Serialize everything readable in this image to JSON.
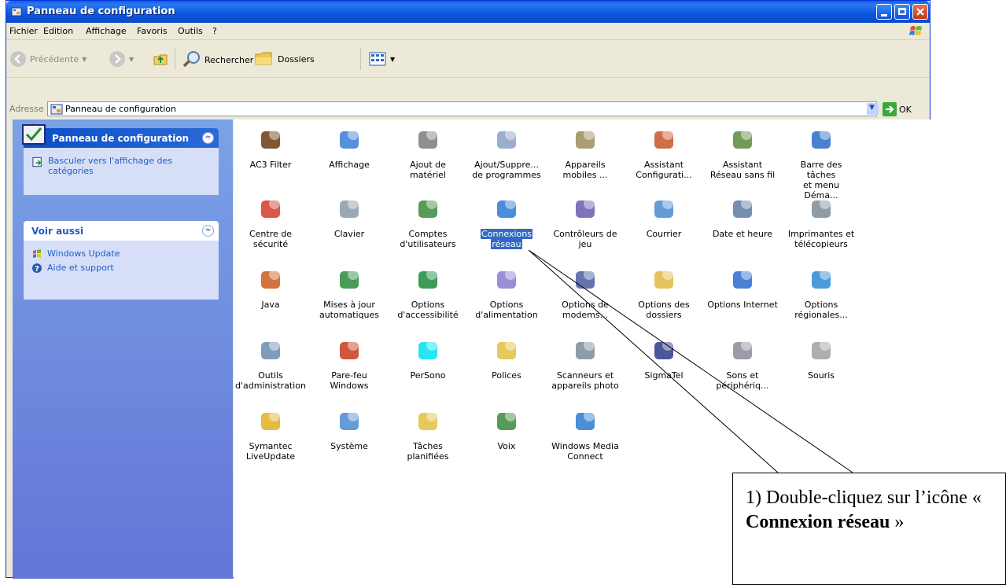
{
  "window": {
    "title": "Panneau de configuration"
  },
  "menu": [
    "Fichier",
    "Edition",
    "Affichage",
    "Favoris",
    "Outils",
    "?"
  ],
  "toolbar": {
    "back": "Précédente",
    "search": "Rechercher",
    "folders": "Dossiers"
  },
  "address": {
    "label": "Adresse",
    "value": "Panneau de configuration",
    "go": "OK"
  },
  "sidebar": {
    "panel_title": "Panneau de configuration",
    "switch_link": "Basculer vers l'affichage des catégories",
    "see_also_title": "Voir aussi",
    "see_also": [
      "Windows Update",
      "Aide et support"
    ]
  },
  "items": [
    {
      "line1": "AC3 Filter",
      "line2": "",
      "icon": "ac3-filter-icon",
      "color": "#6b3a10"
    },
    {
      "line1": "Affichage",
      "line2": "",
      "icon": "display-icon",
      "color": "#3a7bd5"
    },
    {
      "line1": "Ajout de",
      "line2": "matériel",
      "icon": "add-hardware-icon",
      "color": "#7a7a7a"
    },
    {
      "line1": "Ajout/Suppre...",
      "line2": "de programmes",
      "icon": "add-remove-programs-icon",
      "color": "#8aa0c8"
    },
    {
      "line1": "Appareils",
      "line2": "mobiles ...",
      "icon": "mobile-devices-icon",
      "color": "#9c8c5a"
    },
    {
      "line1": "Assistant",
      "line2": "Configurati...",
      "icon": "setup-wizard-icon",
      "color": "#c8552a"
    },
    {
      "line1": "Assistant",
      "line2": "Réseau sans fil",
      "icon": "wireless-network-icon",
      "color": "#5a8a3a"
    },
    {
      "line1": "Barre des tâches",
      "line2": "et menu Déma...",
      "icon": "taskbar-icon",
      "color": "#2a6ac8"
    },
    {
      "line1": "Centre de",
      "line2": "sécurité",
      "icon": "security-center-icon",
      "color": "#d43a2a"
    },
    {
      "line1": "Clavier",
      "line2": "",
      "icon": "keyboard-icon",
      "color": "#8a9aaa"
    },
    {
      "line1": "Comptes",
      "line2": "d'utilisateurs",
      "icon": "user-accounts-icon",
      "color": "#3a8a3a"
    },
    {
      "line1": "Connexions",
      "line2": "réseau",
      "icon": "network-connections-icon",
      "color": "#2a7ad5"
    },
    {
      "line1": "Contrôleurs de",
      "line2": "jeu",
      "icon": "game-controller-icon",
      "color": "#6a5ab0"
    },
    {
      "line1": "Courrier",
      "line2": "",
      "icon": "mail-icon",
      "color": "#4a8ad0"
    },
    {
      "line1": "Date et heure",
      "line2": "",
      "icon": "date-time-icon",
      "color": "#5a7aa0"
    },
    {
      "line1": "Imprimantes et",
      "line2": "télécopieurs",
      "icon": "printers-icon",
      "color": "#7a8a9a"
    },
    {
      "line1": "Java",
      "line2": "",
      "icon": "java-icon",
      "color": "#c85a1a"
    },
    {
      "line1": "Mises à jour",
      "line2": "automatiques",
      "icon": "automatic-updates-icon",
      "color": "#2a8a3a"
    },
    {
      "line1": "Options",
      "line2": "d'accessibilité",
      "icon": "accessibility-icon",
      "color": "#1a8a3a"
    },
    {
      "line1": "Options",
      "line2": "d'alimentation",
      "icon": "power-options-icon",
      "color": "#8a7ad0"
    },
    {
      "line1": "Options de",
      "line2": "modems...",
      "icon": "modem-icon",
      "color": "#4a5aa0"
    },
    {
      "line1": "Options des",
      "line2": "dossiers",
      "icon": "folder-options-icon",
      "color": "#e0b840"
    },
    {
      "line1": "Options Internet",
      "line2": "",
      "icon": "internet-options-icon",
      "color": "#2a6ad0"
    },
    {
      "line1": "Options",
      "line2": "régionales...",
      "icon": "regional-options-icon",
      "color": "#2a8ad0"
    },
    {
      "line1": "Outils",
      "line2": "d'administration",
      "icon": "admin-tools-icon",
      "color": "#6a8ab0"
    },
    {
      "line1": "Pare-feu",
      "line2": "Windows",
      "icon": "firewall-icon",
      "color": "#c83a1a"
    },
    {
      "line1": "PerSono",
      "line2": "",
      "icon": "persono-icon",
      "color": "#00e0f0"
    },
    {
      "line1": "Polices",
      "line2": "",
      "icon": "fonts-icon",
      "color": "#e0c040"
    },
    {
      "line1": "Scanneurs et",
      "line2": "appareils photo",
      "icon": "scanner-icon",
      "color": "#7a8a9a"
    },
    {
      "line1": "SigmaTel",
      "line2": "",
      "icon": "sigmatel-icon",
      "color": "#2a3a8a"
    },
    {
      "line1": "Sons et",
      "line2": "périphériq...",
      "icon": "sounds-icon",
      "color": "#8a8a9a"
    },
    {
      "line1": "Souris",
      "line2": "",
      "icon": "mouse-icon",
      "color": "#a0a0a0"
    },
    {
      "line1": "Symantec",
      "line2": "LiveUpdate",
      "icon": "symantec-icon",
      "color": "#e0b020"
    },
    {
      "line1": "Système",
      "line2": "",
      "icon": "system-icon",
      "color": "#4a8ad0"
    },
    {
      "line1": "Tâches",
      "line2": "planifiées",
      "icon": "scheduled-tasks-icon",
      "color": "#e0c040"
    },
    {
      "line1": "Voix",
      "line2": "",
      "icon": "speech-icon",
      "color": "#3a8a3a"
    },
    {
      "line1": "Windows Media",
      "line2": "Connect",
      "icon": "media-connect-icon",
      "color": "#2a7ad0"
    }
  ],
  "selected_item": "Connexions réseau",
  "callout": {
    "prefix": "1) Double-cliquez sur l’icône « ",
    "bold": "Connexion réseau",
    "suffix": " »"
  }
}
